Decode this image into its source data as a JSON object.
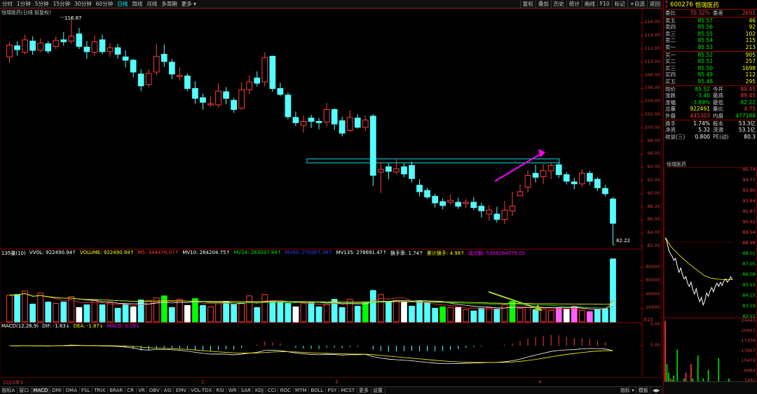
{
  "toolbar": {
    "tabs": [
      "分时",
      "1分钟",
      "5分钟",
      "15分钟",
      "30分钟",
      "60分钟",
      "日线",
      "周线",
      "月线",
      "多周期",
      "更多 ▾"
    ],
    "active": "日线",
    "right_tabs": [
      "复权",
      "叠加",
      "历史",
      "统计",
      "画线",
      "F10",
      "标记",
      "+自选",
      "返回"
    ]
  },
  "stock": {
    "name_label": "恒瑞医药(日线 前复权)",
    "code": "600276",
    "name": "恒瑞医药"
  },
  "price_axis": [
    "116.00",
    "114.00",
    "112.00",
    "110.00",
    "108.00",
    "106.00",
    "104.00",
    "102.00",
    "100.00",
    "98.00",
    "96.00",
    "94.00",
    "92.00",
    "90.00",
    "88.00",
    "86.00",
    "84.00",
    "82.00"
  ],
  "high_mark": "116.87",
  "low_mark": "82.22",
  "volume_header": {
    "prefix": "135量(10)",
    "vvol": "VVOL: 922490.94↑",
    "volume": "VOLUME: 922490.94↑",
    "m5": "M5: 344476.07↑",
    "mv10": "MV10: 264204.75↑",
    "mv24": "MV24: 263037.94↑",
    "mv60": "MV60: 276007.36↑",
    "mv135": "MV135: 276691.47↑",
    "turnover": "换手率: 1.74↑",
    "cum_turnover": "累计换手: 4.98↑",
    "amount": "成交额: 5386264576.00"
  },
  "volume_axis": [
    "80000",
    "60000",
    "40000",
    "20000"
  ],
  "volume_unit": "X10",
  "macd_header": {
    "name": "MACD(12,26,9)",
    "dif": "DIF: -1.83↓",
    "dea": "DEA: -1.87↓",
    "macd": "MACD: 0.09↓"
  },
  "macd_axis": [
    "5.00",
    "0.00"
  ],
  "date_axis": [
    "2020年3",
    "2",
    "3",
    "4"
  ],
  "bottom_tabs": [
    "指标A",
    "窗口",
    "MACD",
    "DMI",
    "DMA",
    "FSL",
    "TRIX",
    "BRAR",
    "CR",
    "VR",
    "OBV",
    "ASI",
    "EMV",
    "VOL-TDX",
    "RSI",
    "WR",
    "SAR",
    "KDJ",
    "CCI",
    "ROC",
    "MTM",
    "BOLL",
    "PSY",
    "MCST",
    "更多",
    "设置"
  ],
  "bottom_right": [
    "指标 ▾",
    "模板",
    "◀▶"
  ],
  "quote": {
    "ratio_label": "委比",
    "ratio": "70.32%",
    "diff_label": "委差",
    "diff": "2691",
    "asks": [
      {
        "label": "卖五",
        "price": "85.57",
        "vol": "46"
      },
      {
        "label": "卖四",
        "price": "85.56",
        "vol": "92"
      },
      {
        "label": "卖三",
        "price": "85.55",
        "vol": "102"
      },
      {
        "label": "卖二",
        "price": "85.54",
        "vol": "115"
      },
      {
        "label": "卖一",
        "price": "85.53",
        "vol": "213"
      }
    ],
    "bids": [
      {
        "label": "买一",
        "price": "85.52",
        "vol": "905"
      },
      {
        "label": "买二",
        "price": "85.51",
        "vol": "257"
      },
      {
        "label": "买三",
        "price": "85.50",
        "vol": "1698"
      },
      {
        "label": "买四",
        "price": "85.49",
        "vol": "112"
      },
      {
        "label": "买五",
        "price": "85.48",
        "vol": "295"
      }
    ],
    "stats": [
      {
        "l1": "现价",
        "v1": "85.52",
        "c1": "green",
        "l2": "今开",
        "v2": "89.45",
        "c2": "red"
      },
      {
        "l1": "涨跌",
        "v1": "-3.46",
        "c1": "green",
        "l2": "最高",
        "v2": "89.45",
        "c2": "red"
      },
      {
        "l1": "涨幅",
        "v1": "-3.89%",
        "c1": "green",
        "l2": "最低",
        "v2": "82.22",
        "c2": "green"
      },
      {
        "l1": "总量",
        "v1": "922491",
        "c1": "yellow",
        "l2": "量比",
        "v2": "4.75",
        "c2": "red"
      },
      {
        "l1": "外盘",
        "v1": "445303",
        "c1": "red",
        "l2": "内盘",
        "v2": "477188",
        "c2": "green"
      }
    ],
    "stats2": [
      {
        "l1": "换手",
        "v1": "1.74%",
        "c1": "white",
        "l2": "股本",
        "v2": "53.3亿",
        "c2": "white"
      },
      {
        "l1": "净资",
        "v1": "5.32",
        "c1": "white",
        "l2": "流通",
        "v2": "53.1亿",
        "c2": "white"
      },
      {
        "l1": "收益(三)",
        "v1": "0.800",
        "c1": "white",
        "l2": "PE(动)",
        "v2": "80.3",
        "c2": "white"
      }
    ]
  },
  "mini_chart": {
    "title": "恒瑞医药",
    "price_axis": [
      "95.74",
      "94.77",
      "93.80",
      "92.84",
      "91.87",
      "90.91",
      "89.94",
      "88.98",
      "88.01",
      "87.05",
      "86.08",
      "85.12",
      "84.15",
      "83.19",
      "82.22"
    ],
    "vol_axis": [
      "24443",
      "20951",
      "17459",
      "13967",
      "10476",
      "6984",
      "3492"
    ]
  },
  "colors": {
    "up": "#ff3c3c",
    "down": "#54ffff",
    "bg": "#000000",
    "ma5": "#ffffff",
    "ma10": "#ffff00"
  },
  "chart_data": {
    "type": "candlestick",
    "title": "恒瑞医药(日线 前复权)",
    "candles": [
      [
        110.8,
        112.6,
        113.1,
        109.9,
        "up"
      ],
      [
        112.5,
        111.9,
        113.2,
        111.0,
        "down"
      ],
      [
        111.5,
        113.4,
        114.2,
        111.2,
        "up"
      ],
      [
        113.2,
        111.8,
        113.9,
        111.1,
        "down"
      ],
      [
        111.8,
        112.9,
        113.6,
        111.5,
        "up"
      ],
      [
        112.8,
        111.7,
        113.2,
        111.3,
        "down"
      ],
      [
        112.4,
        113.3,
        113.9,
        112.0,
        "up"
      ],
      [
        113.4,
        113.1,
        114.6,
        112.5,
        "down"
      ],
      [
        113.2,
        114.0,
        116.9,
        112.8,
        "up"
      ],
      [
        114.3,
        112.4,
        115.2,
        112.0,
        "down"
      ],
      [
        112.3,
        111.6,
        113.2,
        110.5,
        "down"
      ],
      [
        111.5,
        113.1,
        114.1,
        111.0,
        "up"
      ],
      [
        113.4,
        111.6,
        114.2,
        111.2,
        "down"
      ],
      [
        111.6,
        112.2,
        112.9,
        110.8,
        "up"
      ],
      [
        112.2,
        111.2,
        112.8,
        110.5,
        "down"
      ],
      [
        110.8,
        110.3,
        111.8,
        109.2,
        "down"
      ],
      [
        110.3,
        108.5,
        110.5,
        107.7,
        "down"
      ],
      [
        108.2,
        106.4,
        108.9,
        105.6,
        "down"
      ],
      [
        106.6,
        108.3,
        108.9,
        106.2,
        "up"
      ],
      [
        108.5,
        110.9,
        112.8,
        108.0,
        "up"
      ],
      [
        111.2,
        110.1,
        112.7,
        109.3,
        "down"
      ],
      [
        110.0,
        108.2,
        110.5,
        107.4,
        "down"
      ],
      [
        107.8,
        108.0,
        109.2,
        107.2,
        "up"
      ],
      [
        107.9,
        106.0,
        108.3,
        105.6,
        "down"
      ],
      [
        106.0,
        104.5,
        107.1,
        103.7,
        "down"
      ],
      [
        104.6,
        103.9,
        105.2,
        102.8,
        "down"
      ],
      [
        103.5,
        103.7,
        104.8,
        103.2,
        "up"
      ],
      [
        103.5,
        105.6,
        106.8,
        103.1,
        "up"
      ],
      [
        105.5,
        104.5,
        106.2,
        103.6,
        "down"
      ],
      [
        104.2,
        102.8,
        104.6,
        102.3,
        "down"
      ],
      [
        103.0,
        105.8,
        106.9,
        102.8,
        "up"
      ],
      [
        105.8,
        107.0,
        108.0,
        105.1,
        "up"
      ],
      [
        107.6,
        106.8,
        108.6,
        106.3,
        "down"
      ],
      [
        107.0,
        110.7,
        111.5,
        106.3,
        "up"
      ],
      [
        110.9,
        106.0,
        111.0,
        105.5,
        "down"
      ],
      [
        106.0,
        105.1,
        106.9,
        104.8,
        "down"
      ],
      [
        105.0,
        101.7,
        105.4,
        101.3,
        "down"
      ],
      [
        101.6,
        100.8,
        102.5,
        100.3,
        "down"
      ],
      [
        100.4,
        101.0,
        101.9,
        99.3,
        "up"
      ],
      [
        101.5,
        101.0,
        102.0,
        100.0,
        "down"
      ],
      [
        101.0,
        100.8,
        101.5,
        99.8,
        "down"
      ],
      [
        100.9,
        102.8,
        103.8,
        100.2,
        "up"
      ],
      [
        102.8,
        100.6,
        103.0,
        99.7,
        "down"
      ],
      [
        101.1,
        99.2,
        101.7,
        98.7,
        "down"
      ],
      [
        99.6,
        101.6,
        102.7,
        99.4,
        "up"
      ],
      [
        101.5,
        100.1,
        102.1,
        99.9,
        "down"
      ],
      [
        100.1,
        101.2,
        101.9,
        99.5,
        "up"
      ],
      [
        101.8,
        92.8,
        102.1,
        91.2,
        "down"
      ],
      [
        93.3,
        93.7,
        94.8,
        90.1,
        "up"
      ],
      [
        94.1,
        93.4,
        94.6,
        92.2,
        "down"
      ],
      [
        93.3,
        93.8,
        95.4,
        92.9,
        "up"
      ],
      [
        94.1,
        93.0,
        94.6,
        92.5,
        "down"
      ],
      [
        94.3,
        92.3,
        94.9,
        91.7,
        "down"
      ],
      [
        91.3,
        90.3,
        92.2,
        89.6,
        "down"
      ],
      [
        90.5,
        89.5,
        90.9,
        89.2,
        "down"
      ],
      [
        89.6,
        88.6,
        90.0,
        87.9,
        "down"
      ],
      [
        88.8,
        88.2,
        89.3,
        87.6,
        "down"
      ],
      [
        88.7,
        89.0,
        89.9,
        88.3,
        "up"
      ],
      [
        88.7,
        88.1,
        89.4,
        87.7,
        "down"
      ],
      [
        88.5,
        88.7,
        89.2,
        87.8,
        "up"
      ],
      [
        88.7,
        87.9,
        89.5,
        87.5,
        "down"
      ],
      [
        88.1,
        87.4,
        88.6,
        86.4,
        "down"
      ],
      [
        86.9,
        87.5,
        88.3,
        85.9,
        "up"
      ],
      [
        86.9,
        86.1,
        88.0,
        85.6,
        "down"
      ],
      [
        86.1,
        87.5,
        88.9,
        85.4,
        "up"
      ],
      [
        87.4,
        88.1,
        90.3,
        86.6,
        "up"
      ],
      [
        89.7,
        90.3,
        91.4,
        89.6,
        "up"
      ],
      [
        91.0,
        92.8,
        93.6,
        90.2,
        "up"
      ],
      [
        93.1,
        92.5,
        94.4,
        91.7,
        "down"
      ],
      [
        92.6,
        93.5,
        94.5,
        91.5,
        "up"
      ],
      [
        93.5,
        94.3,
        94.7,
        92.2,
        "up"
      ],
      [
        94.4,
        92.9,
        94.8,
        92.4,
        "down"
      ],
      [
        92.9,
        91.9,
        93.3,
        91.4,
        "down"
      ],
      [
        91.8,
        91.5,
        92.4,
        90.7,
        "down"
      ],
      [
        91.5,
        93.1,
        93.7,
        91.0,
        "up"
      ],
      [
        93.1,
        91.9,
        93.5,
        91.3,
        "down"
      ],
      [
        92.2,
        90.9,
        92.5,
        90.4,
        "down"
      ],
      [
        90.8,
        90.0,
        91.3,
        89.6,
        "down"
      ],
      [
        89.2,
        85.5,
        89.5,
        82.2,
        "down"
      ]
    ],
    "volumes": [
      39,
      40,
      45,
      26,
      42,
      29,
      27,
      29,
      37,
      21,
      25,
      32,
      25,
      28,
      20,
      25,
      22,
      32,
      31,
      35,
      38,
      21,
      33,
      24,
      34,
      24,
      22,
      28,
      30,
      26,
      27,
      38,
      21,
      40,
      30,
      29,
      27,
      22,
      28,
      29,
      22,
      25,
      33,
      21,
      33,
      23,
      29,
      46,
      40,
      29,
      31,
      29,
      23,
      30,
      28,
      20,
      22,
      21,
      21,
      18,
      16,
      20,
      21,
      19,
      25,
      30,
      20,
      21,
      18,
      19,
      17,
      21,
      19,
      23,
      17,
      15,
      18,
      19,
      92
    ],
    "volume_ylim": [
      0,
      95000
    ],
    "ylim": [
      82,
      116.9
    ]
  }
}
